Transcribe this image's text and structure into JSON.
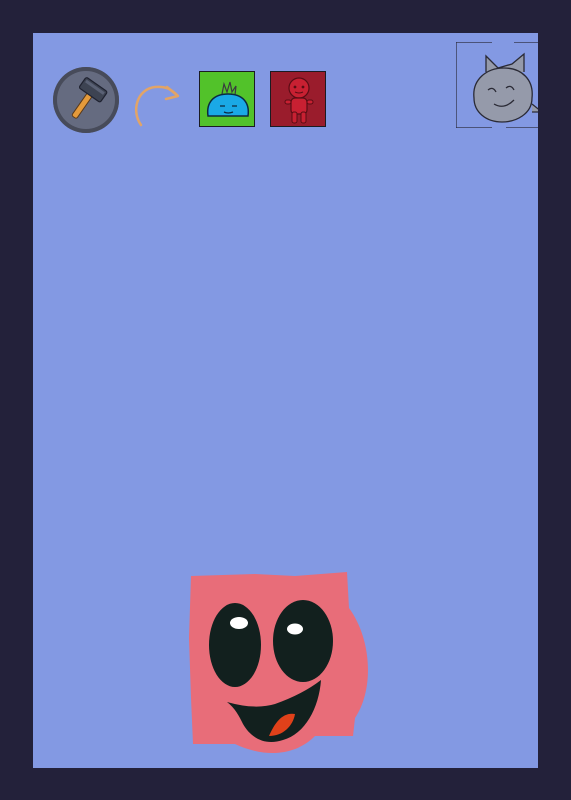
{
  "game": {
    "tool_slot": {
      "icon": "hammer-icon",
      "ring_color": "#474b5a",
      "fill_color": "#656b80"
    },
    "redo": {
      "icon": "curved-arrow-icon",
      "color": "#e2a467"
    },
    "cards": [
      {
        "id": "blue-slime",
        "icon": "blue-slime-icon",
        "bg_color": "#52c22a"
      },
      {
        "id": "red-doll",
        "icon": "red-doll-icon",
        "bg_color": "#9a1c2c"
      }
    ],
    "portrait": {
      "icon": "gray-cat-face-icon",
      "color": "#959aaa"
    },
    "character": {
      "icon": "pink-blob-face-icon",
      "color": "#e86d79"
    },
    "colors": {
      "background": "#8399e3",
      "border": "#23213a"
    }
  }
}
